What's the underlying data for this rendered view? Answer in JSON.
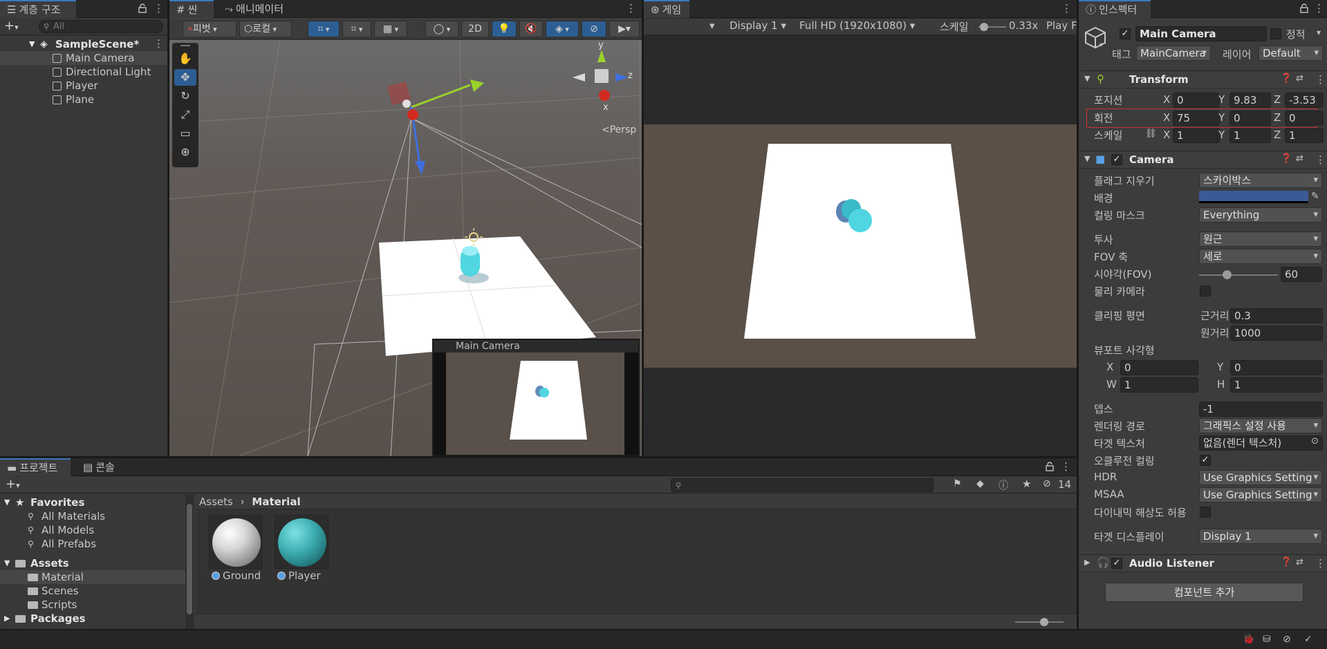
{
  "hierarchy": {
    "tab_label": "계층 구조",
    "search_placeholder": "All",
    "scene_name": "SampleScene*",
    "objects": [
      "Main Camera",
      "Directional Light",
      "Player",
      "Plane"
    ]
  },
  "scene": {
    "tab_label": "씬",
    "animator_tab_label": "애니메이터",
    "pivot_label": "피벗",
    "local_label": "로컬",
    "mode_2d": "2D",
    "gizmo_axes": {
      "x": "x",
      "y": "y",
      "z": "z"
    },
    "persp_label": "<Persp",
    "camera_preview_title": "Main Camera"
  },
  "game": {
    "tab_label": "게임",
    "display": "Display 1",
    "resolution": "Full HD (1920x1080)",
    "scale_label": "스케일",
    "scale_value": "0.33x",
    "play_label": "Play F"
  },
  "inspector": {
    "tab_label": "인스펙터",
    "object_name": "Main Camera",
    "static_label": "정적",
    "tag_label": "태그",
    "tag_value": "MainCamera",
    "layer_label": "레이어",
    "layer_value": "Default",
    "transform": {
      "title": "Transform",
      "position_label": "포지션",
      "position": {
        "x": "0",
        "y": "9.83",
        "z": "-3.53"
      },
      "rotation_label": "회전",
      "rotation": {
        "x": "75",
        "y": "0",
        "z": "0"
      },
      "scale_label": "스케일",
      "scale": {
        "x": "1",
        "y": "1",
        "z": "1"
      },
      "axis_x": "X",
      "axis_y": "Y",
      "axis_z": "Z"
    },
    "camera": {
      "title": "Camera",
      "clear_flags_label": "플래그 지우기",
      "clear_flags_value": "스카이박스",
      "background_label": "배경",
      "background_color": "#3a5a97",
      "culling_mask_label": "컬링 마스크",
      "culling_mask_value": "Everything",
      "projection_label": "투사",
      "projection_value": "원근",
      "fov_axis_label": "FOV 축",
      "fov_axis_value": "세로",
      "fov_label": "시야각(FOV)",
      "fov_value": "60",
      "physical_label": "물리 카메라",
      "clipping_label": "클리핑 평면",
      "near_label": "근거리",
      "near_value": "0.3",
      "far_label": "원거리",
      "far_value": "1000",
      "viewport_label": "뷰포트 사각형",
      "vp_x_label": "X",
      "vp_x": "0",
      "vp_y_label": "Y",
      "vp_y": "0",
      "vp_w_label": "W",
      "vp_w": "1",
      "vp_h_label": "H",
      "vp_h": "1",
      "depth_label": "뎁스",
      "depth_value": "-1",
      "render_path_label": "렌더링 경로",
      "render_path_value": "그래픽스 설정 사용",
      "target_texture_label": "타겟 텍스처",
      "target_texture_value": "없음(렌더 텍스처)",
      "occlusion_label": "오클루전 컬링",
      "hdr_label": "HDR",
      "hdr_value": "Use Graphics Setting",
      "msaa_label": "MSAA",
      "msaa_value": "Use Graphics Setting",
      "dynamic_res_label": "다이내믹 해상도 허용",
      "target_display_label": "타겟 디스플레이",
      "target_display_value": "Display 1"
    },
    "audio_listener_title": "Audio Listener",
    "add_component_label": "컴포넌트 추가"
  },
  "project": {
    "tab_label": "프로젝트",
    "console_tab_label": "콘솔",
    "favorites_label": "Favorites",
    "favorites": [
      "All Materials",
      "All Models",
      "All Prefabs"
    ],
    "assets_label": "Assets",
    "asset_folders": [
      "Material",
      "Scenes",
      "Scripts"
    ],
    "packages_label": "Packages",
    "breadcrumb_root": "Assets",
    "breadcrumb_current": "Material",
    "hidden_count": "14",
    "materials": [
      {
        "name": "Ground",
        "color": "#d8d8d8"
      },
      {
        "name": "Player",
        "color": "#3fb0b4"
      }
    ]
  },
  "colors": {
    "accent": "#3a79bb",
    "highlight_box": "#d03030",
    "capsule": "#4fd6e0",
    "ground": "#ffffff"
  }
}
